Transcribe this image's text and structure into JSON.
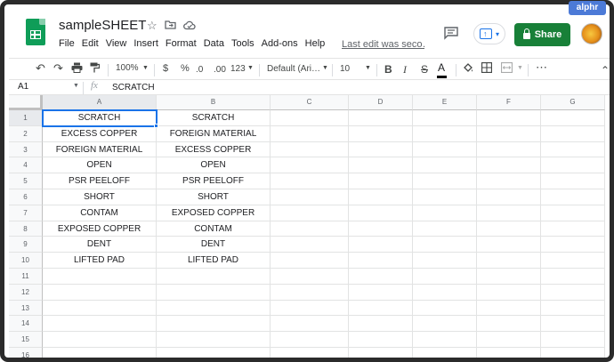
{
  "app": {
    "doc_title": "sampleSHEET",
    "menu": [
      "File",
      "Edit",
      "View",
      "Insert",
      "Format",
      "Data",
      "Tools",
      "Add-ons",
      "Help"
    ],
    "last_edit": "Last edit was seco…",
    "share_label": "Share",
    "watermark": "alphr",
    "icons": {
      "star": "star-icon",
      "move": "move-to-folder-icon",
      "cloud": "cloud-status-icon",
      "comment": "comment-icon",
      "present": "present-icon"
    },
    "colors": {
      "brand_green": "#0f9d58",
      "share": "#188038",
      "accent": "#1a73e8"
    }
  },
  "toolbar": {
    "zoom": "100%",
    "currency": "$",
    "percent": "%",
    "decrease_decimals": ".0",
    "increase_decimals": ".00",
    "more_formats": "123",
    "font": "Default (Ari…",
    "font_size": "10",
    "bold": "B",
    "italic": "I",
    "strike": "S",
    "text_color": "A",
    "more": "⋯",
    "collapse": "⌃"
  },
  "formula_bar": {
    "name_box": "A1",
    "fx": "fx",
    "content": "SCRATCH"
  },
  "sheet": {
    "columns": [
      "A",
      "B",
      "C",
      "D",
      "E",
      "F",
      "G"
    ],
    "rows": [
      "1",
      "2",
      "3",
      "4",
      "5",
      "6",
      "7",
      "8",
      "9",
      "10",
      "11",
      "12",
      "13",
      "14",
      "15",
      "16"
    ],
    "cells": [
      [
        "SCRATCH",
        "SCRATCH"
      ],
      [
        "EXCESS COPPER",
        "FOREIGN MATERIAL"
      ],
      [
        "FOREIGN MATERIAL",
        "EXCESS COPPER"
      ],
      [
        "OPEN",
        "OPEN"
      ],
      [
        "PSR PEELOFF",
        "PSR PEELOFF"
      ],
      [
        "SHORT",
        "SHORT"
      ],
      [
        "CONTAM",
        "EXPOSED COPPER"
      ],
      [
        "EXPOSED COPPER",
        "CONTAM"
      ],
      [
        "DENT",
        "DENT"
      ],
      [
        "LIFTED PAD",
        "LIFTED PAD"
      ]
    ],
    "selected_cell": "A1"
  }
}
